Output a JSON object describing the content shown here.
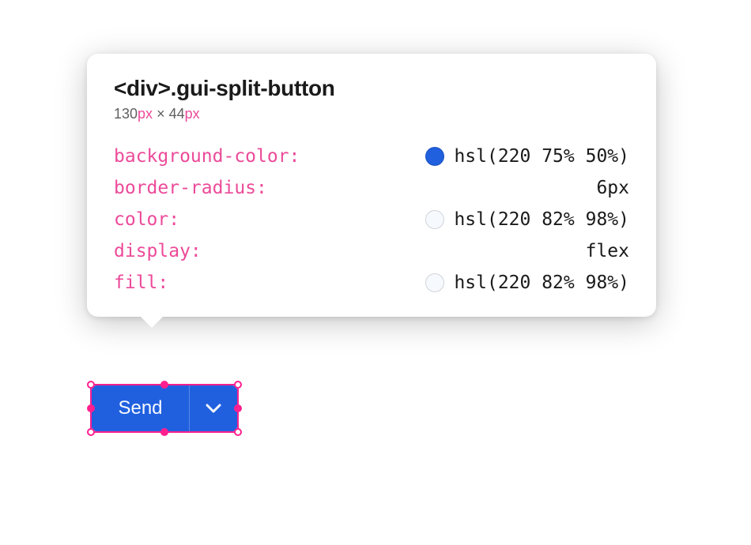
{
  "inspector": {
    "element_tag": "<div>",
    "element_class": ".gui-split-button",
    "width_value": "130",
    "width_unit": "px",
    "dim_separator": " × ",
    "height_value": "44",
    "height_unit": "px",
    "properties": [
      {
        "name": "background-color:",
        "value": "hsl(220 75% 50%)",
        "swatch": "hsl(220, 75%, 50%)"
      },
      {
        "name": "border-radius:",
        "value": "6px",
        "swatch": null
      },
      {
        "name": "color:",
        "value": "hsl(220 82% 98%)",
        "swatch": "hsl(220, 82%, 98%)"
      },
      {
        "name": "display:",
        "value": "flex",
        "swatch": null
      },
      {
        "name": "fill:",
        "value": "hsl(220 82% 98%)",
        "swatch": "hsl(220, 82%, 98%)"
      }
    ]
  },
  "splitButton": {
    "label": "Send"
  }
}
